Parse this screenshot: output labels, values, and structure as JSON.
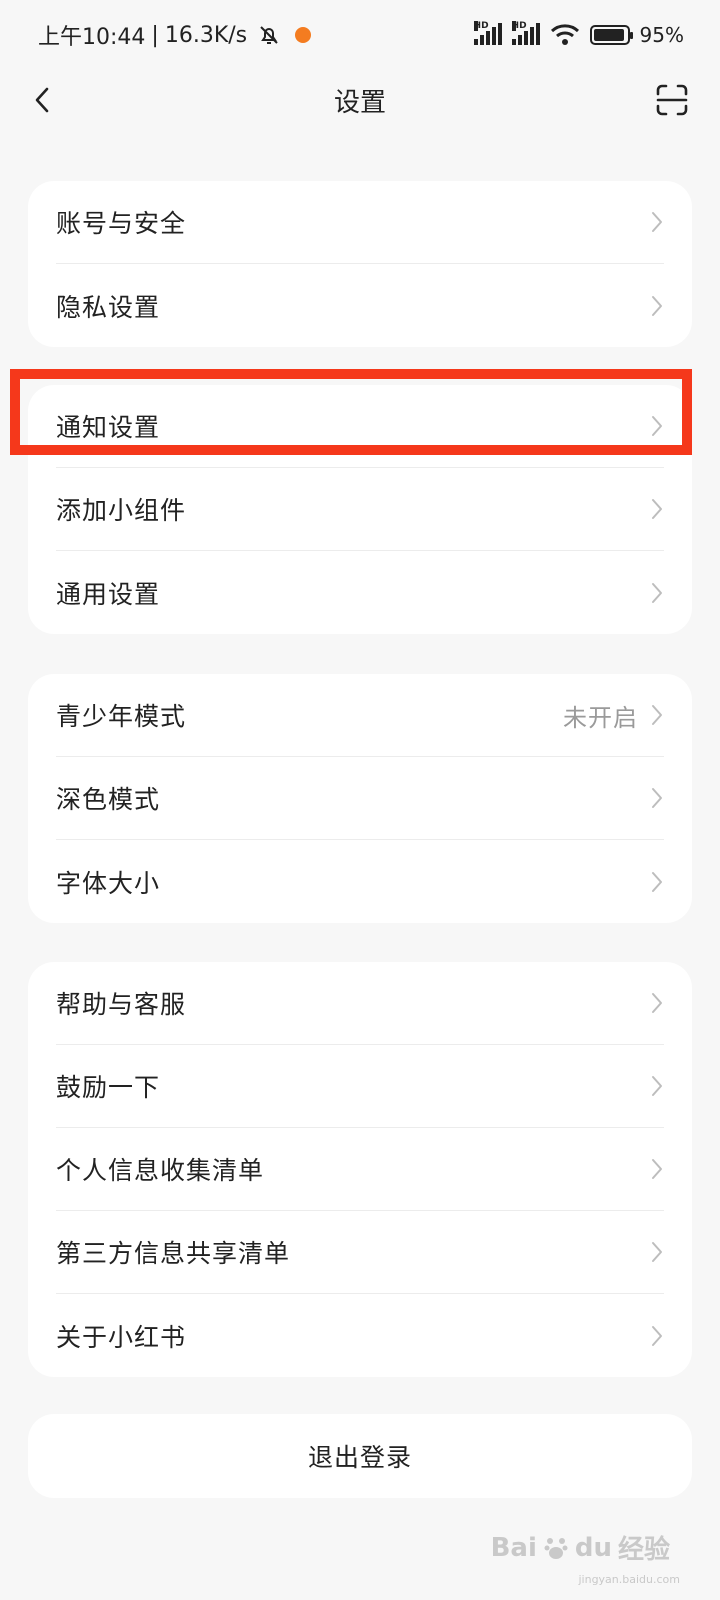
{
  "status_bar": {
    "time": "上午10:44",
    "speed": "16.3K/s",
    "hd1": "HD",
    "hd2": "HD",
    "battery_percent": "95%",
    "battery_level": 0.95,
    "icons": [
      "mute-bell-icon",
      "app-notification-dot-icon",
      "signal-icon",
      "signal-icon",
      "wifi-icon",
      "battery-icon"
    ]
  },
  "header": {
    "title": "设置",
    "back_icon": "chevron-left-icon",
    "scan_icon": "scan-icon"
  },
  "groups": [
    {
      "items": [
        {
          "label": "账号与安全"
        },
        {
          "label": "隐私设置"
        }
      ]
    },
    {
      "items": [
        {
          "label": "通知设置"
        },
        {
          "label": "添加小组件"
        },
        {
          "label": "通用设置"
        }
      ]
    },
    {
      "items": [
        {
          "label": "青少年模式",
          "value": "未开启"
        },
        {
          "label": "深色模式"
        },
        {
          "label": "字体大小"
        }
      ]
    },
    {
      "items": [
        {
          "label": "帮助与客服"
        },
        {
          "label": "鼓励一下"
        },
        {
          "label": "个人信息收集清单"
        },
        {
          "label": "第三方信息共享清单"
        },
        {
          "label": "关于小红书"
        }
      ]
    }
  ],
  "logout_label": "退出登录",
  "watermark": {
    "brand": "Bai",
    "brand2": "du",
    "product": "经验",
    "url": "jingyan.baidu.com"
  },
  "colors": {
    "highlight": "#f5381b",
    "background": "#f7f7f7",
    "card": "#ffffff",
    "secondary_text": "#9a9a9a"
  }
}
